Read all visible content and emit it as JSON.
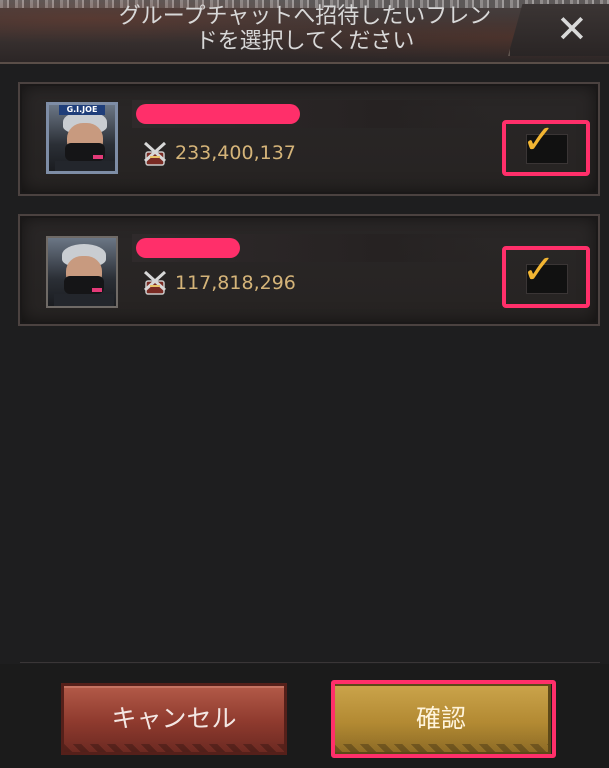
{
  "header": {
    "title_line1": "グループチャットへ招待したいフレン",
    "title_line2": "ドを選択してください",
    "close_label": "✕"
  },
  "friends": [
    {
      "power": "233,400,137",
      "selected": true,
      "checkmark": "✓",
      "avatar_badge": "G.I.JOE"
    },
    {
      "power": "117,818,296",
      "selected": true,
      "checkmark": "✓"
    }
  ],
  "buttons": {
    "cancel": "キャンセル",
    "confirm": "確認"
  },
  "colors": {
    "highlight": "#ff2f6a",
    "power_text": "#d5b479",
    "checkmark": "#f2b532",
    "cancel_button": "#9a4535",
    "confirm_button": "#c29a42"
  },
  "icons": {
    "power": "power-sword-icon",
    "close": "close-icon",
    "check": "checkmark-icon"
  }
}
